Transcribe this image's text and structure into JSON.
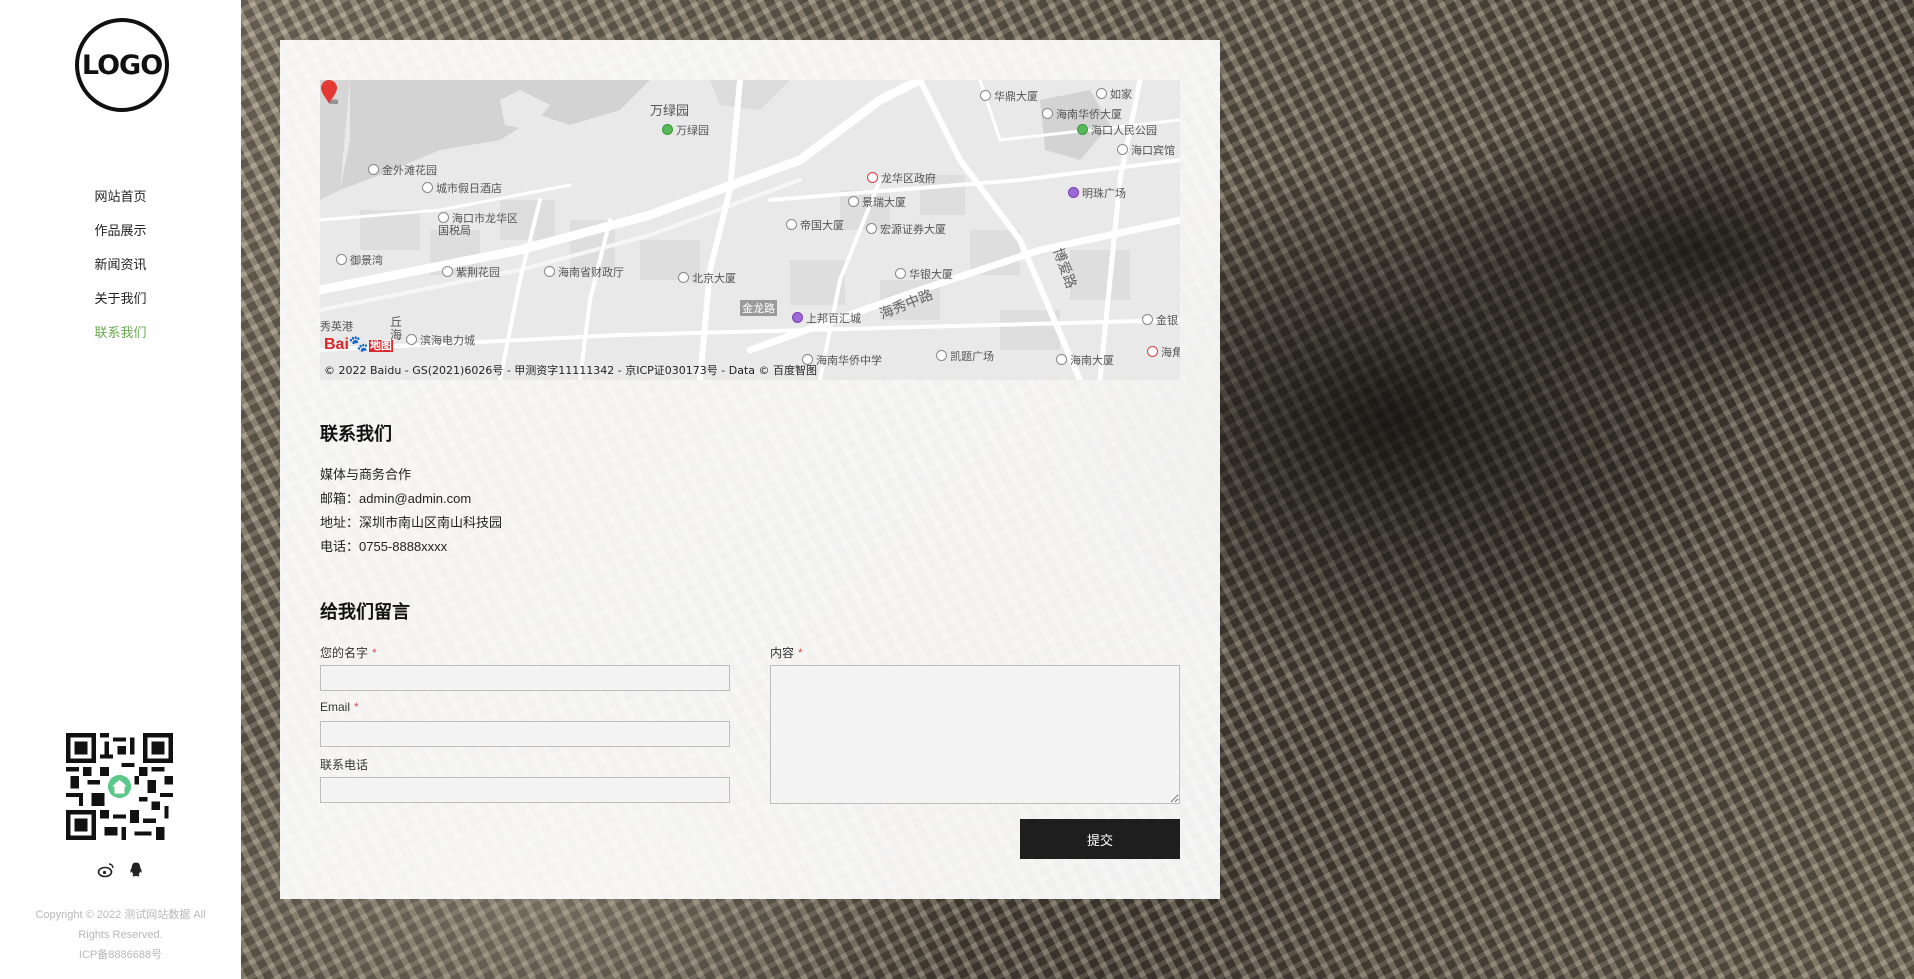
{
  "sidebar": {
    "logo_text": "LOGO",
    "nav": [
      {
        "label": "网站首页",
        "active": false
      },
      {
        "label": "作品展示",
        "active": false
      },
      {
        "label": "新闻资讯",
        "active": false
      },
      {
        "label": "关于我们",
        "active": false
      },
      {
        "label": "联系我们",
        "active": true
      }
    ],
    "social_icons": [
      "weibo-icon",
      "qq-icon"
    ],
    "copyright_line1": "Copyright © 2022 测试网站数据 All",
    "copyright_line2": "Rights Reserved.",
    "icp": "ICP备8886688号"
  },
  "map": {
    "copyright": "© 2022 Baidu - GS(2021)6026号 - 甲测资字11111342 - 京ICP证030173号 - Data © 百度智图",
    "baidu_logo": "Bai",
    "baidu_logo_suffix": "地图",
    "labels": [
      "万绿园",
      "万绿园",
      "华鼎大厦",
      "如家",
      "海南华侨大厦",
      "海口人民公园",
      "海口宾馆",
      "金外滩花园",
      "城市假日酒店",
      "海口市龙华区国税局",
      "龙华区政府",
      "景瑞大厦",
      "明珠广场",
      "帝国大厦",
      "宏源证券大厦",
      "御景湾",
      "紫荆花园",
      "海南省财政厅",
      "北京大厦",
      "华银大厦",
      "滨海电力城",
      "金龙路",
      "上邦百汇城",
      "海南华侨中学",
      "凯题广场",
      "海南大厦",
      "金银",
      "海角",
      "秀英港",
      "丘海"
    ],
    "roads": [
      "海秀中路",
      "博爱路"
    ]
  },
  "contact": {
    "title": "联系我们",
    "line1": "媒体与商务合作",
    "email_label": "邮箱：",
    "email": "admin@admin.com",
    "address_label": "地址：",
    "address": "深圳市南山区南山科技园",
    "phone_label": "电话：",
    "phone": "0755-8888xxxx"
  },
  "form": {
    "title": "给我们留言",
    "name_label": "您的名字",
    "email_label": "Email",
    "phone_label": "联系电话",
    "content_label": "内容",
    "required_mark": "*",
    "submit_label": "提交"
  }
}
